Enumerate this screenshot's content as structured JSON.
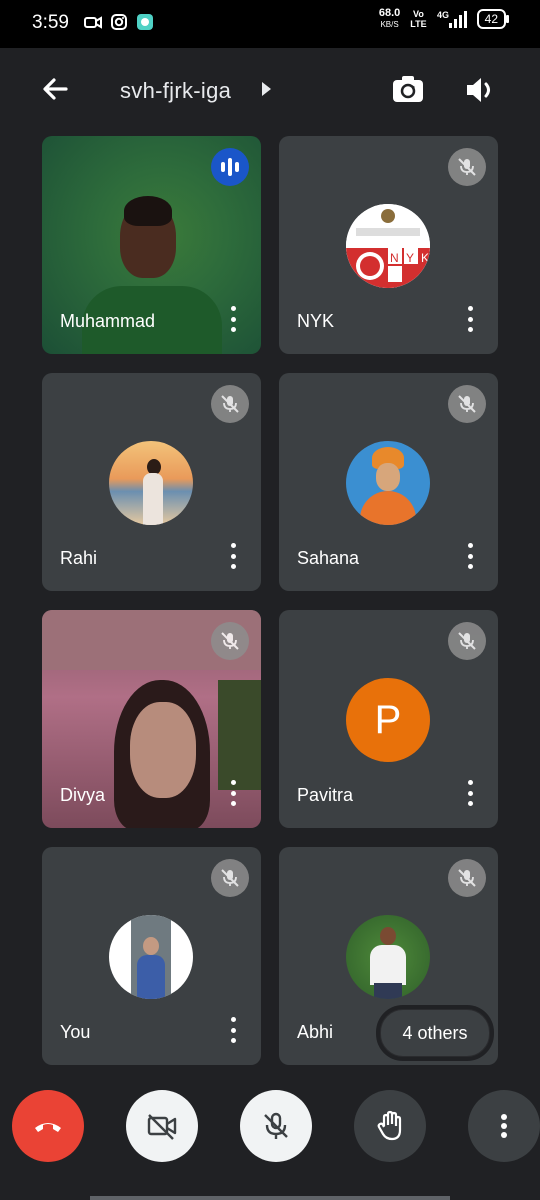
{
  "status_bar": {
    "time": "3:59",
    "net_speed": "68.0",
    "net_speed_unit": "KB/S",
    "volte_top": "Vo",
    "volte_bottom": "LTE",
    "network": "4G",
    "battery": "42"
  },
  "header": {
    "meeting_code": "svh-fjrk-iga"
  },
  "participants": [
    {
      "name": "Muhammad",
      "tile": "video",
      "speaking": true
    },
    {
      "name": "NYK",
      "tile": "avatar",
      "muted": true
    },
    {
      "name": "Rahi",
      "tile": "avatar",
      "muted": true
    },
    {
      "name": "Sahana",
      "tile": "avatar",
      "muted": true
    },
    {
      "name": "Divya",
      "tile": "video",
      "muted": true
    },
    {
      "name": "Pavitra",
      "tile": "initial",
      "initial": "P",
      "avatar_color": "#e8710a",
      "muted": true
    },
    {
      "name": "You",
      "tile": "avatar",
      "muted": true
    },
    {
      "name": "Abhi",
      "tile": "avatar",
      "muted": true
    }
  ],
  "others_pill": "4 others",
  "nyk_logo_text": "NYK",
  "colors": {
    "background": "#202124",
    "tile": "#3c4043",
    "end_call": "#ea4335",
    "speaking": "#1a56c9"
  }
}
